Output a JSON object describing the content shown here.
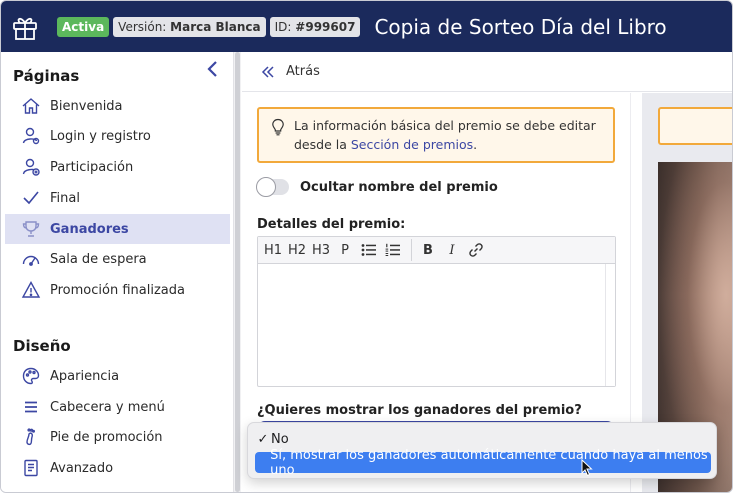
{
  "header": {
    "status_badge": "Activa",
    "version_label": "Versión:",
    "version_value": "Marca Blanca",
    "id_label": "ID:",
    "id_value": "#999607",
    "title": "Copia de Sorteo Día del Libro",
    "icon": "gift-icon"
  },
  "sidebar": {
    "pages_title": "Páginas",
    "design_title": "Diseño",
    "pages": [
      {
        "label": "Bienvenida",
        "icon": "home-icon"
      },
      {
        "label": "Login y registro",
        "icon": "user-login-icon"
      },
      {
        "label": "Participación",
        "icon": "user-add-icon"
      },
      {
        "label": "Final",
        "icon": "check-icon"
      },
      {
        "label": "Ganadores",
        "icon": "trophy-icon",
        "active": true
      },
      {
        "label": "Sala de espera",
        "icon": "gauge-icon"
      },
      {
        "label": "Promoción finalizada",
        "icon": "warning-icon"
      }
    ],
    "design": [
      {
        "label": "Apariencia",
        "icon": "palette-icon"
      },
      {
        "label": "Cabecera y menú",
        "icon": "menu-icon"
      },
      {
        "label": "Pie de promoción",
        "icon": "footprint-icon"
      },
      {
        "label": "Avanzado",
        "icon": "document-icon"
      }
    ]
  },
  "topbar": {
    "back_label": "Atrás"
  },
  "info": {
    "text_before": "La información básica del premio se debe editar desde la ",
    "link": "Sección de premios",
    "text_after": "."
  },
  "toggle": {
    "label": "Ocultar nombre del premio",
    "on": false
  },
  "details": {
    "label": "Detalles del premio:",
    "toolbar": [
      "H1",
      "H2",
      "H3",
      "P"
    ],
    "bold": "B",
    "italic": "I"
  },
  "question": {
    "label": "¿Quieres mostrar los ganadores del premio?"
  },
  "dropdown": {
    "checkmark": "✓",
    "options": [
      {
        "label": "No",
        "checked": true
      },
      {
        "label": "Sí, mostrar los ganadores automáticamente cuando haya al menos uno",
        "highlighted": true
      }
    ]
  },
  "colors": {
    "header_bg": "#1b2a5c",
    "accent": "#3c47a3",
    "active_badge": "#5cb85c",
    "warning_border": "#f2a93b",
    "highlight": "#3d7ef0"
  }
}
